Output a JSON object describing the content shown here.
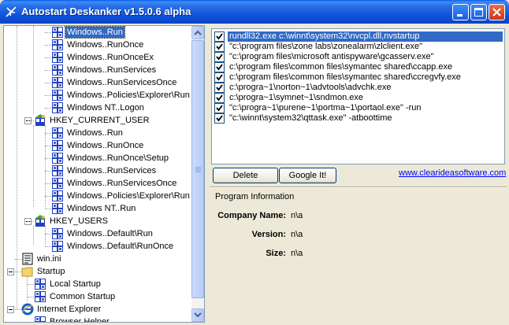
{
  "window": {
    "title": "Autostart Deskanker v1.5.0.6 alpha"
  },
  "tree": {
    "items": [
      {
        "label": "Windows..Run",
        "selected": true
      },
      {
        "label": "Windows..RunOnce"
      },
      {
        "label": "Windows..RunOnceEx"
      },
      {
        "label": "Windows..RunServices"
      },
      {
        "label": "Windows..RunServicesOnce"
      },
      {
        "label": "Windows..Policies\\Explorer\\Run"
      },
      {
        "label": "Windows NT..Logon"
      },
      {
        "label": "HKEY_CURRENT_USER"
      },
      {
        "label": "Windows..Run"
      },
      {
        "label": "Windows..RunOnce"
      },
      {
        "label": "Windows..RunOnce\\Setup"
      },
      {
        "label": "Windows..RunServices"
      },
      {
        "label": "Windows..RunServicesOnce"
      },
      {
        "label": "Windows..Policies\\Explorer\\Run"
      },
      {
        "label": "Windows NT..Run"
      },
      {
        "label": "HKEY_USERS"
      },
      {
        "label": "Windows..Default\\Run"
      },
      {
        "label": "Windows..Default\\RunOnce"
      },
      {
        "label": "win.ini"
      },
      {
        "label": "Startup"
      },
      {
        "label": "Local Startup"
      },
      {
        "label": "Common Startup"
      },
      {
        "label": "Internet Explorer"
      },
      {
        "label": "Browser Helper"
      }
    ]
  },
  "list": {
    "entries": [
      {
        "text": "rundll32.exe c:\\winnt\\system32\\nvcpl.dll,nvstartup",
        "checked": true,
        "selected": true
      },
      {
        "text": "\"c:\\program files\\zone labs\\zonealarm\\zlclient.exe\"",
        "checked": true
      },
      {
        "text": "\"c:\\program files\\microsoft antispyware\\gcasserv.exe\"",
        "checked": true
      },
      {
        "text": "c:\\program files\\common files\\symantec shared\\ccapp.exe",
        "checked": true
      },
      {
        "text": "c:\\program files\\common files\\symantec shared\\ccregvfy.exe",
        "checked": true
      },
      {
        "text": "c:\\progra~1\\norton~1\\advtools\\advchk.exe",
        "checked": true
      },
      {
        "text": "c:\\progra~1\\symnet~1\\sndmon.exe",
        "checked": true
      },
      {
        "text": "\"c:\\progra~1\\purene~1\\portma~1\\portaol.exe\" -run",
        "checked": true
      },
      {
        "text": "\"c:\\winnt\\system32\\qttask.exe\" -atboottime",
        "checked": true
      }
    ]
  },
  "buttons": {
    "delete": "Delete",
    "google": "Google It!"
  },
  "link": "www.clearideasoftware.com",
  "info": {
    "title": "Program Information",
    "company_label": "Company Name:",
    "company_value": "n\\a",
    "version_label": "Version:",
    "version_value": "n\\a",
    "size_label": "Size:",
    "size_value": "n\\a"
  }
}
